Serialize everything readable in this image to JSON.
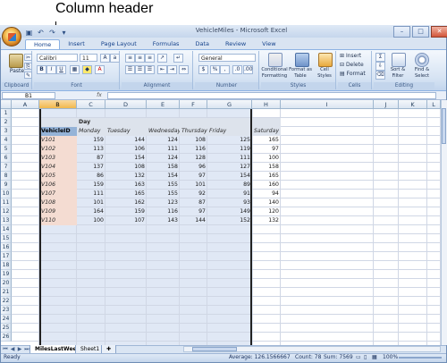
{
  "callout": {
    "text": "Column header"
  },
  "window": {
    "title": "VehicleMiles - Microsoft Excel"
  },
  "qat": {
    "icons": [
      "save-icon",
      "undo-icon",
      "redo-icon",
      "dropdown-icon"
    ]
  },
  "ribbon": {
    "tabs": [
      "Home",
      "Insert",
      "Page Layout",
      "Formulas",
      "Data",
      "Review",
      "View"
    ],
    "active_tab": "Home",
    "groups": {
      "clipboard": {
        "label": "Clipboard",
        "paste": "Paste"
      },
      "font": {
        "label": "Font",
        "name": "Calibri",
        "size": "11"
      },
      "alignment": {
        "label": "Alignment"
      },
      "number": {
        "label": "Number",
        "format": "General",
        "dollar": "$",
        "percent": "%",
        "comma": ","
      },
      "styles": {
        "label": "Styles",
        "cond_fmt": "Conditional Formatting",
        "fmt_table": "Format as Table",
        "cell_styles": "Cell Styles"
      },
      "cells": {
        "label": "Cells",
        "insert": "Insert",
        "delete": "Delete",
        "format": "Format"
      },
      "editing": {
        "label": "Editing",
        "sort": "Sort & Filter",
        "find": "Find & Select"
      }
    }
  },
  "formula_bar": {
    "name_box": "B1",
    "fx": "fx",
    "content": ""
  },
  "columns": [
    "A",
    "B",
    "C",
    "D",
    "E",
    "F",
    "G",
    "H",
    "I",
    "J",
    "K",
    "L"
  ],
  "selected_column": "B",
  "rows": [
    "1",
    "2",
    "3",
    "4",
    "5",
    "6",
    "7",
    "8",
    "9",
    "10",
    "11",
    "12",
    "13",
    "14",
    "15",
    "16",
    "17",
    "18",
    "19",
    "20",
    "21",
    "22",
    "23",
    "24",
    "25",
    "26"
  ],
  "sheet": {
    "day_label": "Day",
    "id_header": "VehicleID",
    "days": [
      "Monday",
      "Tuesday",
      "Wednesday",
      "Thursday",
      "Friday",
      "Saturday"
    ],
    "records": [
      {
        "id": "V101",
        "values": [
          "159",
          "144",
          "124",
          "108",
          "125",
          "165"
        ]
      },
      {
        "id": "V102",
        "values": [
          "113",
          "106",
          "111",
          "116",
          "119",
          "97"
        ]
      },
      {
        "id": "V103",
        "values": [
          "87",
          "154",
          "124",
          "128",
          "111",
          "100"
        ]
      },
      {
        "id": "V104",
        "values": [
          "137",
          "108",
          "158",
          "96",
          "127",
          "158"
        ]
      },
      {
        "id": "V105",
        "values": [
          "86",
          "132",
          "154",
          "97",
          "154",
          "165"
        ]
      },
      {
        "id": "V106",
        "values": [
          "159",
          "163",
          "155",
          "101",
          "89",
          "160"
        ]
      },
      {
        "id": "V107",
        "values": [
          "111",
          "165",
          "155",
          "92",
          "91",
          "94"
        ]
      },
      {
        "id": "V108",
        "values": [
          "101",
          "162",
          "123",
          "87",
          "93",
          "140"
        ]
      },
      {
        "id": "V109",
        "values": [
          "164",
          "159",
          "116",
          "97",
          "149",
          "120"
        ]
      },
      {
        "id": "V110",
        "values": [
          "100",
          "107",
          "143",
          "144",
          "152",
          "132"
        ]
      }
    ]
  },
  "sheet_tabs": [
    "MilesLastWeek",
    "Sheet1"
  ],
  "active_sheet": "MilesLastWeek",
  "status": {
    "ready": "Ready",
    "average": "Average: 126.1566667",
    "count": "Count: 78",
    "sum": "Sum: 7569",
    "zoom": "100%"
  }
}
